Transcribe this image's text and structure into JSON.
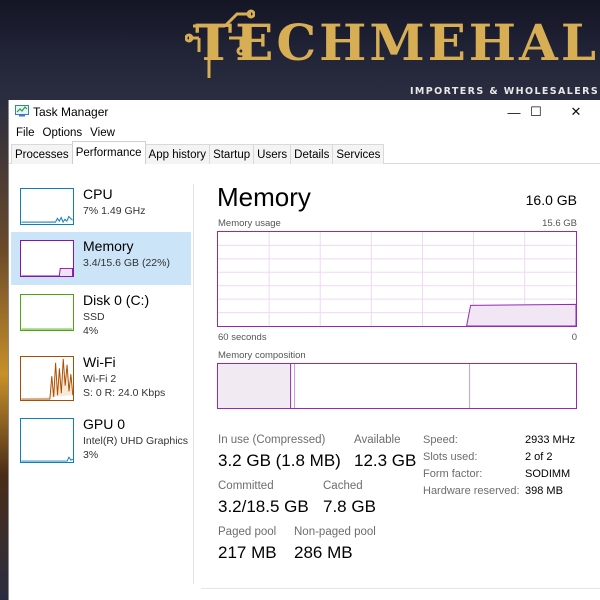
{
  "banner": {
    "brand": "TECHMEHAL",
    "tagline": "IMPORTERS & WHOLESALERS"
  },
  "window": {
    "title": "Task Manager",
    "controls": {
      "minimize": "—",
      "maximize": "☐",
      "close": "✕"
    },
    "menu": [
      "File",
      "Options",
      "View"
    ],
    "tabs": [
      "Processes",
      "Performance",
      "App history",
      "Startup",
      "Users",
      "Details",
      "Services"
    ],
    "active_tab": "Performance"
  },
  "sidebar": {
    "items": [
      {
        "name": "CPU",
        "line1": "7%  1.49 GHz",
        "line2": "",
        "color": "#117dbb"
      },
      {
        "name": "Memory",
        "line1": "3.4/15.6 GB (22%)",
        "line2": "",
        "color": "#8b12ae",
        "selected": true
      },
      {
        "name": "Disk 0 (C:)",
        "line1": "SSD",
        "line2": "4%",
        "color": "#4da60c"
      },
      {
        "name": "Wi-Fi",
        "line1": "Wi-Fi 2",
        "line2": "S: 0  R: 24.0 Kbps",
        "color": "#a74f01"
      },
      {
        "name": "GPU 0",
        "line1": "Intel(R) UHD Graphics",
        "line2": "3%",
        "color": "#117dbb"
      }
    ]
  },
  "memory": {
    "title": "Memory",
    "total": "16.0 GB",
    "usage_label": "Memory usage",
    "usage_max": "15.6 GB",
    "time_left": "60 seconds",
    "time_right": "0",
    "composition_label": "Memory composition",
    "usage_level": 0.22,
    "stats": {
      "in_use_label": "In use (Compressed)",
      "in_use_value": "3.2 GB (1.8 MB)",
      "available_label": "Available",
      "available_value": "12.3 GB",
      "committed_label": "Committed",
      "committed_value": "3.2/18.5 GB",
      "cached_label": "Cached",
      "cached_value": "7.8 GB",
      "paged_label": "Paged pool",
      "paged_value": "217 MB",
      "nonpaged_label": "Non-paged pool",
      "nonpaged_value": "286 MB"
    },
    "details": {
      "speed_label": "Speed:",
      "speed_value": "2933 MHz",
      "slots_label": "Slots used:",
      "slots_value": "2 of 2",
      "form_label": "Form factor:",
      "form_value": "SODIMM",
      "hw_label": "Hardware reserved:",
      "hw_value": "398 MB"
    }
  },
  "colors": {
    "memory_accent": "#9528b4",
    "selection": "#cce4f7",
    "brand_gold": "#d8ae55"
  }
}
